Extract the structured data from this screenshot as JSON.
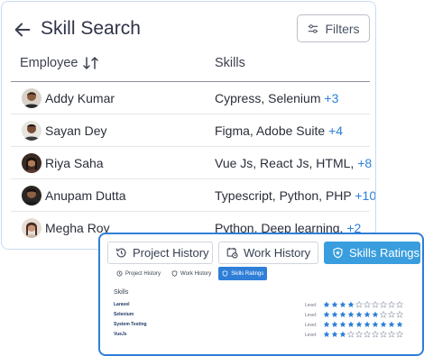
{
  "header": {
    "title": "Skill Search",
    "filters_label": "Filters"
  },
  "table": {
    "col_employee": "Employee",
    "col_skills": "Skills",
    "rows": [
      {
        "name": "Addy Kumar",
        "skills": "Cypress, Selenium",
        "more": "+3"
      },
      {
        "name": "Sayan Dey",
        "skills": "Figma, Adobe Suite",
        "more": "+4"
      },
      {
        "name": "Riya Saha",
        "skills": "Vue Js, React Js, HTML,",
        "more": "+8"
      },
      {
        "name": "Anupam Dutta",
        "skills": "Typescript, Python, PHP",
        "more": "+10"
      },
      {
        "name": "Megha Roy",
        "skills": "Python, Deep learning,",
        "more": "+2"
      }
    ]
  },
  "popup": {
    "tabs": [
      "Project History",
      "Work History",
      "Skills Ratings"
    ],
    "small_tabs": [
      "Project History",
      "Work History",
      "Skills Ratings"
    ],
    "skills_heading": "Skills",
    "level_label": "Level:",
    "ratings": [
      {
        "skill": "Laravel",
        "stars": 4,
        "max": 10
      },
      {
        "skill": "Selenium",
        "stars": 7,
        "max": 10
      },
      {
        "skill": "System Testing",
        "stars": 10,
        "max": 10
      },
      {
        "skill": "VueJs",
        "stars": 3,
        "max": 10
      }
    ]
  },
  "colors": {
    "accent": "#2f7fd8",
    "active_tab": "#3a9ede",
    "star_filled": "#2f7fd8",
    "star_empty": "#9ca3af"
  }
}
